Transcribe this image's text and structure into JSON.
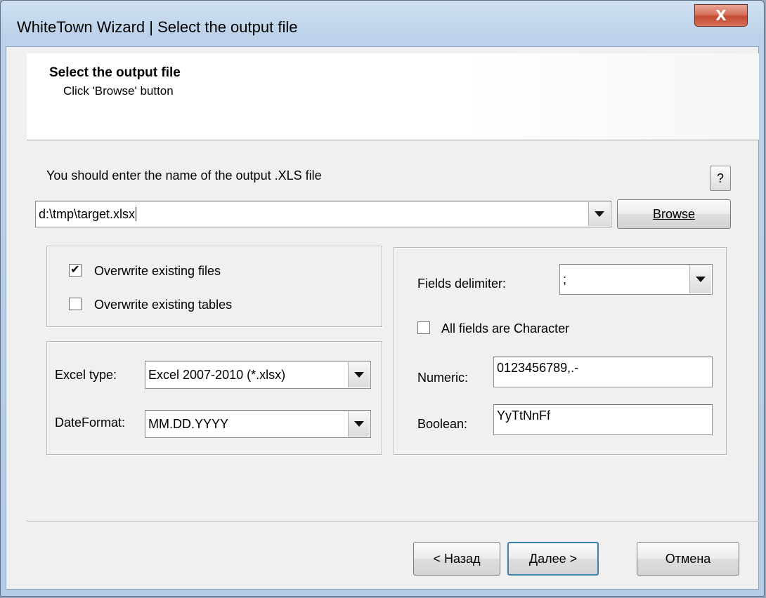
{
  "window": {
    "title": "WhiteTown Wizard | Select the output file",
    "close_glyph": "X"
  },
  "header": {
    "title": "Select the output file",
    "subtitle": "Click 'Browse' button"
  },
  "output": {
    "prompt": "You should enter the name of the output .XLS file",
    "help_label": "?",
    "path_value": "d:\\tmp\\target.xlsx",
    "browse_label": "Browse"
  },
  "overwrite": {
    "files_label": "Overwrite existing files",
    "files_checked": true,
    "tables_label": "Overwrite existing tables",
    "tables_checked": false
  },
  "excel": {
    "type_label": "Excel type:",
    "type_value": "Excel 2007-2010 (*.xlsx)",
    "dateformat_label": "DateFormat:",
    "dateformat_value": "MM.DD.YYYY"
  },
  "fields": {
    "delimiter_label": "Fields delimiter:",
    "delimiter_value": ";",
    "all_char_label": "All fields are Character",
    "all_char_checked": false,
    "numeric_label": "Numeric:",
    "numeric_value": "0123456789,.-",
    "boolean_label": "Boolean:",
    "boolean_value": "YyTtNnFf"
  },
  "footer": {
    "back_label": "< Назад",
    "next_label": "Далее >",
    "cancel_label": "Отмена"
  },
  "check_glyph": "✔"
}
